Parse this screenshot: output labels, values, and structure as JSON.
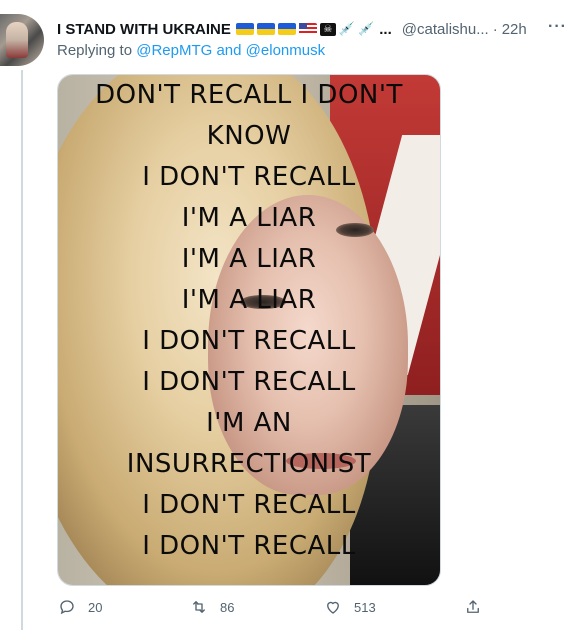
{
  "tweet": {
    "display_name": "I STAND WITH UKRAINE",
    "name_badges": [
      "flag-ua-icon",
      "flag-ua-icon",
      "flag-ua-icon",
      "flag-us-icon",
      "pirate-flag-icon",
      "syringe-icon",
      "syringe-icon"
    ],
    "name_overflow": "...",
    "handle": "@catalishu...",
    "separator": "·",
    "time": "22h",
    "more": "···",
    "reply_prefix": "Replying to",
    "reply_mention_1": "@RepMTG",
    "reply_and": "and",
    "reply_mention_2": "@elonmusk"
  },
  "media_caption": [
    "DON'T RECALL I DON'T",
    "KNOW",
    "I DON'T RECALL",
    "I'M A LIAR",
    "I'M A LIAR",
    "I'M A LIAR",
    "I DON'T RECALL",
    "I DON'T RECALL",
    "I'M AN",
    "INSURRECTIONIST",
    "I DON'T RECALL",
    "I DON'T RECALL"
  ],
  "actions": {
    "reply_count": "20",
    "retweet_count": "86",
    "like_count": "513"
  },
  "colors": {
    "link": "#1d9bf0",
    "secondary": "#536471",
    "text": "#0f1419"
  }
}
